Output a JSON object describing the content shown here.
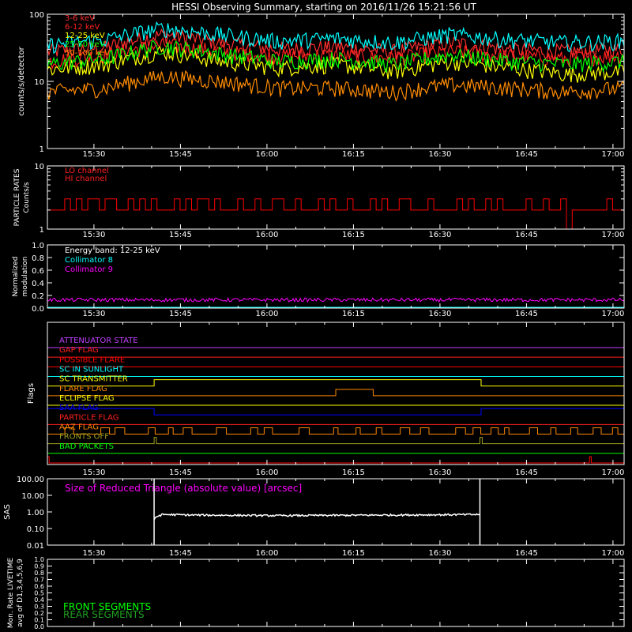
{
  "title": "HESSI Observing Summary, starting on 2016/11/26 15:21:56 UT",
  "time_axis": {
    "ticks": [
      "15:30",
      "15:45",
      "16:00",
      "16:15",
      "16:30",
      "16:45",
      "17:00"
    ],
    "range_min": [
      0,
      100
    ],
    "tick_minutes": [
      8.07,
      23.07,
      38.07,
      53.07,
      68.07,
      83.07,
      98.07
    ]
  },
  "colors": {
    "lc_3_6": "#ff3030",
    "lc_6_12": "#ff2020",
    "lc_12_25": "#ffff00",
    "lc_25_50": "#00ff00",
    "lc_50_100": "#ff8c00",
    "lc_cyan": "#00ffff",
    "frame": "#ffffff",
    "magenta": "#ff00ff",
    "red": "#ff0000",
    "green": "#00ff00",
    "darkgreen": "#20a020",
    "blue": "#0000ff",
    "orange": "#ff8800",
    "yellow": "#ffff00",
    "olive": "#a0a020",
    "purple": "#c040ff"
  },
  "chart_data": [
    {
      "id": "lightcurves",
      "type": "line",
      "title": "HESSI Observing Summary, starting on 2016/11/26 15:21:56 UT",
      "ylabel": "counts/s/detector",
      "yscale": "log",
      "ylim": [
        1,
        100
      ],
      "yticks": [
        "1",
        "10",
        "100"
      ],
      "legend_placement": "top-left",
      "series": [
        {
          "name": "3-6 keV",
          "color": "#ff3030",
          "x": [
            0,
            10,
            20,
            30,
            40,
            50,
            60,
            70,
            80,
            90,
            100
          ],
          "values": [
            28,
            32,
            50,
            38,
            30,
            33,
            28,
            38,
            30,
            28,
            30
          ]
        },
        {
          "name": "6-12 keV",
          "color": "#ff2020",
          "x": [
            0,
            10,
            20,
            30,
            40,
            50,
            60,
            70,
            80,
            90,
            100
          ],
          "values": [
            20,
            25,
            35,
            28,
            24,
            25,
            22,
            28,
            24,
            22,
            25
          ]
        },
        {
          "name": "12-25 keV",
          "color": "#ffff00",
          "x": [
            0,
            10,
            20,
            30,
            40,
            50,
            60,
            70,
            80,
            90,
            100
          ],
          "values": [
            15,
            18,
            28,
            20,
            16,
            18,
            14,
            20,
            16,
            13,
            14
          ]
        },
        {
          "name": "25-50 keV",
          "color": "#00ff00",
          "x": [
            0,
            10,
            20,
            30,
            40,
            50,
            60,
            70,
            80,
            90,
            100
          ],
          "values": [
            18,
            22,
            34,
            26,
            20,
            22,
            18,
            25,
            20,
            18,
            20
          ]
        },
        {
          "name": "50-100 keV",
          "color": "#ff8c00",
          "x": [
            0,
            10,
            20,
            30,
            40,
            50,
            60,
            70,
            80,
            90,
            100
          ],
          "values": [
            7,
            8,
            12,
            10,
            8,
            8,
            7,
            9,
            8,
            7,
            8
          ]
        },
        {
          "name": "",
          "color": "#00ffff",
          "x": [
            0,
            10,
            20,
            30,
            40,
            50,
            60,
            70,
            80,
            90,
            100
          ],
          "values": [
            35,
            42,
            62,
            50,
            40,
            44,
            38,
            50,
            42,
            38,
            40
          ]
        }
      ],
      "legend": [
        {
          "label": "3-6 keV",
          "color": "#ff3030"
        },
        {
          "label": "6-12 keV",
          "color": "#ff2020"
        },
        {
          "label": "12-25 keV",
          "color": "#ffff00"
        },
        {
          "label": "25-50 keV",
          "color": "#00ff00"
        },
        {
          "label": "50-100 keV",
          "color": "#ff8c00"
        }
      ]
    },
    {
      "id": "particle",
      "type": "line",
      "ylabel": "PARTICLE RATES",
      "ylabel2": "Counts/s",
      "yscale": "log",
      "ylim": [
        1,
        10
      ],
      "yticks": [
        "1",
        "10"
      ],
      "legend": [
        {
          "label": "LO channel",
          "color": "#ff2020"
        },
        {
          "label": "HI channel",
          "color": "#ff2020"
        }
      ],
      "series": [
        {
          "name": "HI channel",
          "color": "#ff0000",
          "values": [
            2,
            2,
            2,
            3,
            2,
            3,
            2,
            3,
            3,
            2,
            3,
            3,
            2,
            2,
            3,
            2,
            3,
            2,
            3,
            2,
            2,
            2,
            3,
            2,
            3,
            2,
            3,
            3,
            2,
            3,
            2,
            2,
            2,
            3,
            2,
            2,
            3,
            2,
            2,
            3,
            3,
            2,
            2,
            3,
            2,
            2,
            2,
            3,
            2,
            3,
            2,
            2,
            3,
            2,
            2,
            2,
            3,
            2,
            3,
            2,
            2,
            3,
            3,
            2,
            2,
            2,
            3,
            2,
            2,
            2,
            2,
            3,
            2,
            3,
            2,
            2,
            3,
            2,
            3,
            2,
            2,
            2,
            2,
            3,
            2,
            2,
            3,
            2,
            2,
            3,
            1,
            2,
            2,
            2,
            2,
            2,
            2,
            3,
            2,
            2
          ]
        }
      ]
    },
    {
      "id": "modulation",
      "type": "line",
      "ylabel": "Normalized",
      "ylabel2": "modulation",
      "ylim": [
        0,
        1
      ],
      "yticks": [
        "0.0",
        "0.2",
        "0.4",
        "0.6",
        "0.8",
        "1.0"
      ],
      "legend": [
        {
          "label": "Energy band: 12-25 keV",
          "color": "#ffffff"
        },
        {
          "label": "Collimator 8",
          "color": "#00ffff"
        },
        {
          "label": "Collimator 9",
          "color": "#ff00ff"
        }
      ],
      "series": [
        {
          "name": "Collimator 9",
          "color": "#ff00ff",
          "values": [
            0.12,
            0.14
          ]
        }
      ]
    },
    {
      "id": "flags",
      "type": "line",
      "ylabel": "Flags",
      "flags": [
        {
          "label": "ATTENUATOR STATE",
          "color": "#c040ff",
          "on": []
        },
        {
          "label": "GAP FLAG",
          "color": "#ff2020",
          "on": []
        },
        {
          "label": "POSSIBLE FLARE",
          "color": "#ff0000",
          "on": []
        },
        {
          "label": "SC IN SUNLIGHT",
          "color": "#00ffff",
          "on": []
        },
        {
          "label": "SC TRANSMITTER",
          "color": "#ffff00",
          "on": [
            [
              18.5,
              75.2
            ]
          ]
        },
        {
          "label": "FLARE FLAG",
          "color": "#ff8800",
          "on": [
            [
              50.0,
              56.5
            ]
          ]
        },
        {
          "label": "ECLIPSE FLAG",
          "color": "#ffff00",
          "on": []
        },
        {
          "label": "SAA FLAG",
          "color": "#0000ff",
          "on": [
            [
              0,
              18.5
            ],
            [
              75.2,
              100
            ]
          ]
        },
        {
          "label": "PARTICLE FLAG",
          "color": "#ff2020",
          "on": []
        },
        {
          "label": "AAZ FLAG",
          "color": "#ff8800",
          "on": "toggling"
        },
        {
          "label": "FRONTS OFF",
          "color": "#a0a020",
          "on": [
            [
              18.5,
              18.9
            ],
            [
              75.0,
              75.4
            ]
          ]
        },
        {
          "label": "BAD PACKETS",
          "color": "#00ff00",
          "on": []
        },
        {
          "label": "",
          "color": "#ff0000",
          "on": [
            [
              0,
              0.3
            ],
            [
              94.0,
              94.3
            ]
          ]
        }
      ]
    },
    {
      "id": "sas",
      "type": "line",
      "ylabel": "SAS",
      "yscale": "log",
      "ylim": [
        0.01,
        100
      ],
      "yticks": [
        "100.00",
        "10.00",
        "1.00",
        "0.10",
        "0.01"
      ],
      "annotation": "Size of Reduced Triangle (absolute value) [arcsec]",
      "series": [
        {
          "name": "",
          "color": "#ffffff",
          "x": [
            18.5,
            18.8,
            20,
            25,
            40,
            60,
            75.0
          ],
          "values": [
            0.3,
            0.5,
            0.7,
            0.65,
            0.6,
            0.65,
            0.7
          ]
        }
      ]
    },
    {
      "id": "livetime",
      "type": "line",
      "ylabel": "Mon. Rate LIVETIME",
      "ylabel2": "avg of D1,3,4,5,6,9",
      "ylim": [
        0,
        1
      ],
      "yticks": [
        "0.0",
        "0.1",
        "0.2",
        "0.3",
        "0.4",
        "0.5",
        "0.6",
        "0.7",
        "0.8",
        "0.9",
        "1.0"
      ],
      "legend": [
        {
          "label": "FRONT SEGMENTS",
          "color": "#00ff00"
        },
        {
          "label": "REAR SEGMENTS",
          "color": "#20a020"
        }
      ],
      "series": []
    }
  ]
}
